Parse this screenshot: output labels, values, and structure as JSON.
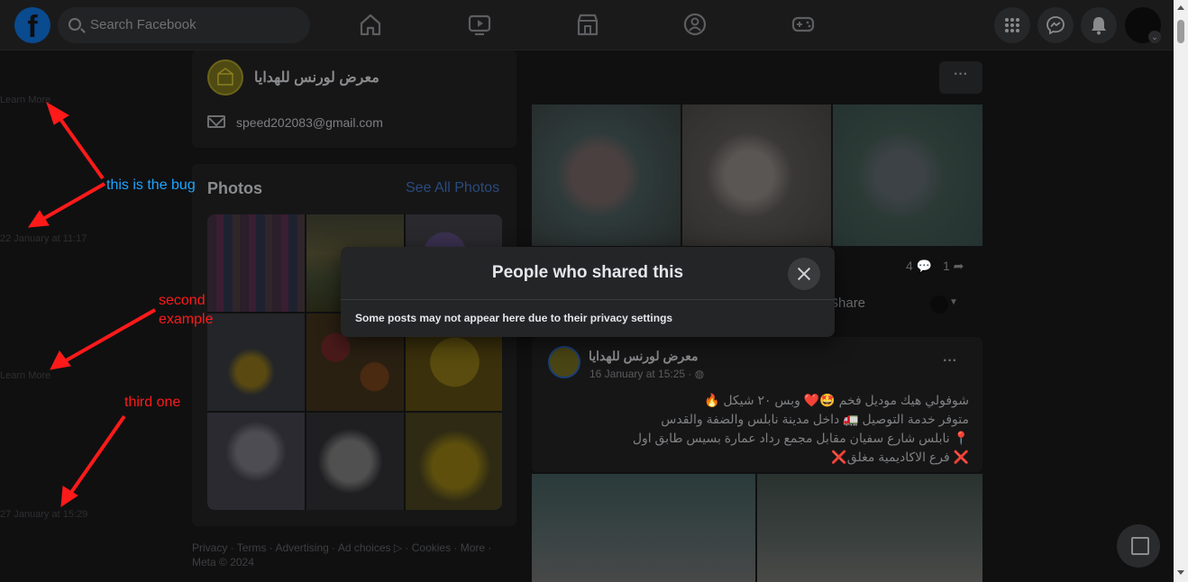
{
  "search": {
    "placeholder": "Search Facebook"
  },
  "left_column": {
    "items": [
      {
        "text": "Learn More"
      },
      {
        "text": "22 January at 11:17"
      },
      {
        "text": "Learn More"
      },
      {
        "text": "27 January at 15:29"
      }
    ]
  },
  "page": {
    "name": "معرض لورنس للهدايا",
    "email": "speed202083@gmail.com"
  },
  "photos": {
    "title": "Photos",
    "see_all": "See All Photos"
  },
  "footer": {
    "text": "Privacy · Terms · Advertising · Ad choices ▷ · Cookies · More · Meta © 2024"
  },
  "feed": {
    "comments": "4",
    "shares": "1",
    "share_label": "Share",
    "post": {
      "author": "معرض لورنس للهدايا",
      "time": "16 January at 15:25 · ",
      "lines": [
        "شوفولي هيك موديل فخم 🤩❤️ وبس ٢٠ شيكل 🔥",
        "متوفر خدمة التوصيل 🚛 داخل مدينة نابلس والضفة والقدس",
        "📍 نابلس شارع سفيان مقابل مجمع رداد عمارة بسيس طابق اول",
        "❌ فرع الاكاديمية مغلق❌"
      ]
    }
  },
  "modal": {
    "title": "People who shared this",
    "note": "Some posts may not appear here due to their privacy settings"
  },
  "annotations": {
    "bug": "this is the bug",
    "second_line1": "second",
    "second_line2": "example",
    "third": "third one"
  },
  "colors": {
    "annotation_blue": "#1fa5ff",
    "annotation_red": "#ff1a1a"
  }
}
